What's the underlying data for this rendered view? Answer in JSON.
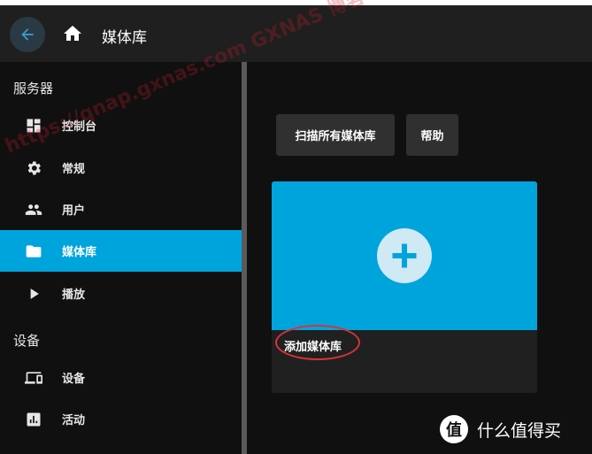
{
  "header": {
    "title": "媒体库"
  },
  "sidebar": {
    "sections": [
      {
        "label": "服务器"
      },
      {
        "label": "设备"
      }
    ],
    "items": [
      {
        "label": "控制台",
        "icon": "dashboard-icon"
      },
      {
        "label": "常规",
        "icon": "gear-icon"
      },
      {
        "label": "用户",
        "icon": "people-icon"
      },
      {
        "label": "媒体库",
        "icon": "folder-icon",
        "active": true
      },
      {
        "label": "播放",
        "icon": "play-icon"
      },
      {
        "label": "设备",
        "icon": "devices-icon"
      },
      {
        "label": "活动",
        "icon": "activity-icon"
      }
    ]
  },
  "main": {
    "scan_button": "扫描所有媒体库",
    "help_button": "帮助",
    "add_card_label": "添加媒体库"
  },
  "watermark": "https://qnap.gxnas.com GXNAS 博客",
  "brand": {
    "glyph": "值",
    "text": "什么值得买"
  },
  "colors": {
    "accent": "#00a4dc",
    "header": "#1f1f1f",
    "background": "#101010",
    "annotation": "#d6343a"
  }
}
